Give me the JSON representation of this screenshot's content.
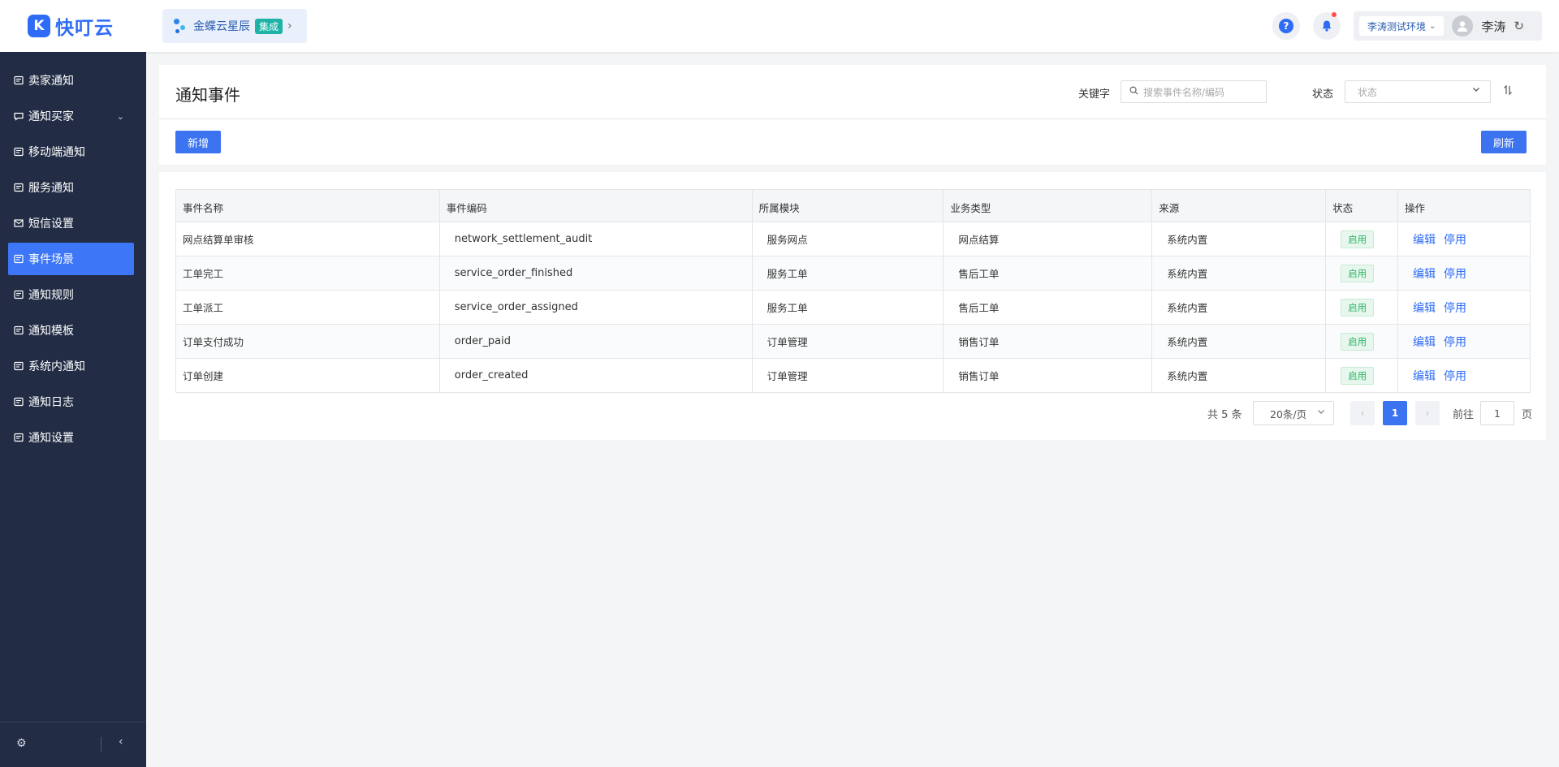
{
  "brand": {
    "logo_mark": "K",
    "name": "快叮云"
  },
  "app": {
    "name": "金蝶云星辰",
    "badge": "集成",
    "chevron": "›"
  },
  "topbar": {
    "help_glyph": "?",
    "env_label": "李涛测试环境",
    "env_chevron": "⌄",
    "user_name": "李涛",
    "refresh_glyph": "↻"
  },
  "sidebar": {
    "items": [
      {
        "label": "卖家通知",
        "icon": "notice-icon"
      },
      {
        "label": "通知买家",
        "icon": "chat-icon",
        "expandable": true
      },
      {
        "label": "移动端通知",
        "icon": "notice-icon"
      },
      {
        "label": "服务通知",
        "icon": "notice-icon"
      },
      {
        "label": "短信设置",
        "icon": "mail-icon"
      },
      {
        "label": "事件场景",
        "icon": "notice-icon",
        "active": true
      },
      {
        "label": "通知规则",
        "icon": "notice-icon"
      },
      {
        "label": "通知模板",
        "icon": "notice-icon"
      },
      {
        "label": "系统内通知",
        "icon": "notice-icon"
      },
      {
        "label": "通知日志",
        "icon": "notice-icon"
      },
      {
        "label": "通知设置",
        "icon": "notice-icon"
      }
    ],
    "expand_glyph": "⌄",
    "footer_gear": "⚙",
    "footer_collapse": "‹"
  },
  "header": {
    "title": "通知事件",
    "keyword_label": "关键字",
    "search_placeholder": "搜索事件名称/编码",
    "status_label": "状态",
    "status_placeholder": "状态",
    "add_label": "新增",
    "refresh_label": "刷新"
  },
  "table": {
    "columns": [
      "事件名称",
      "事件编码",
      "所属模块",
      "业务类型",
      "来源",
      "状态",
      "操作"
    ],
    "rows": [
      {
        "name": "网点结算单审核",
        "code": "network_settlement_audit",
        "module": "服务网点",
        "biz_type": "网点结算",
        "source": "系统内置",
        "status": "启用",
        "edit": "编辑",
        "disable": "停用"
      },
      {
        "name": "工单完工",
        "code": "service_order_finished",
        "module": "服务工单",
        "biz_type": "售后工单",
        "source": "系统内置",
        "status": "启用",
        "edit": "编辑",
        "disable": "停用"
      },
      {
        "name": "工单派工",
        "code": "service_order_assigned",
        "module": "服务工单",
        "biz_type": "售后工单",
        "source": "系统内置",
        "status": "启用",
        "edit": "编辑",
        "disable": "停用"
      },
      {
        "name": "订单支付成功",
        "code": "order_paid",
        "module": "订单管理",
        "biz_type": "销售订单",
        "source": "系统内置",
        "status": "启用",
        "edit": "编辑",
        "disable": "停用"
      },
      {
        "name": "订单创建",
        "code": "order_created",
        "module": "订单管理",
        "biz_type": "销售订单",
        "source": "系统内置",
        "status": "启用",
        "edit": "编辑",
        "disable": "停用"
      }
    ]
  },
  "pagination": {
    "total_text": "共 5 条",
    "page_size": "20条/页",
    "prev": "‹",
    "current_page": "1",
    "next": "›",
    "goto_prefix": "前往",
    "goto_value": "1",
    "goto_suffix": "页"
  },
  "colors": {
    "primary": "#3b73f0",
    "sidebar_bg": "#222d45",
    "sidebar_active": "#3d76f6",
    "status_green": "#2fb566",
    "link_blue": "#2f6cf6"
  }
}
